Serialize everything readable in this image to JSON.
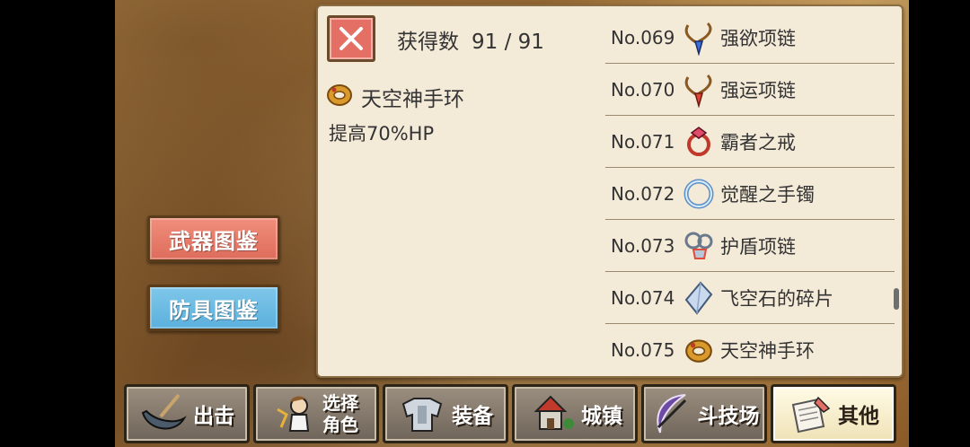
{
  "sidebar": {
    "weapon_label": "武器图鉴",
    "armor_label": "防具图鉴"
  },
  "panel": {
    "close_icon": "close-icon",
    "count_label": "获得数",
    "count_value": "91 / 91",
    "selected": {
      "icon": "bracelet-icon",
      "name": "天空神手环",
      "description": "提高70%HP"
    },
    "items": [
      {
        "no": "No.069",
        "name": "强欲项链",
        "icon": "necklace-blue-icon"
      },
      {
        "no": "No.070",
        "name": "强运项链",
        "icon": "necklace-red-icon"
      },
      {
        "no": "No.071",
        "name": "霸者之戒",
        "icon": "ring-icon"
      },
      {
        "no": "No.072",
        "name": "觉醒之手镯",
        "icon": "bangle-icon"
      },
      {
        "no": "No.073",
        "name": "护盾项链",
        "icon": "shield-necklace-icon"
      },
      {
        "no": "No.074",
        "name": "飞空石的碎片",
        "icon": "crystal-shard-icon"
      },
      {
        "no": "No.075",
        "name": "天空神手环",
        "icon": "bracelet-icon"
      }
    ]
  },
  "nav": [
    {
      "label": "出击",
      "icon": "sortie-icon"
    },
    {
      "label": "选择\n角色",
      "line1": "选择",
      "line2": "角色",
      "icon": "character-icon"
    },
    {
      "label": "装备",
      "icon": "armor-icon"
    },
    {
      "label": "城镇",
      "icon": "town-icon"
    },
    {
      "label": "斗技场",
      "icon": "arena-icon"
    },
    {
      "label": "其他",
      "icon": "scroll-icon"
    }
  ]
}
